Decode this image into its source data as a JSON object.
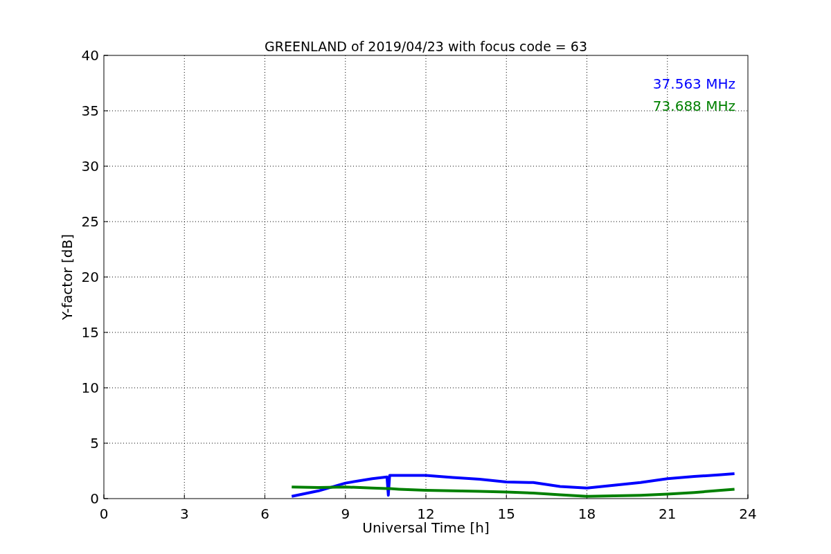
{
  "chart_data": {
    "type": "line",
    "title": "GREENLAND of 2019/04/23 with focus code = 63",
    "xlabel": "Universal Time [h]",
    "ylabel": "Y-factor [dB]",
    "x": [
      7,
      8,
      9,
      10,
      10.55,
      10.6,
      10.65,
      11,
      12,
      13,
      14,
      15,
      16,
      17,
      18,
      19,
      20,
      21,
      22,
      23,
      23.5
    ],
    "series": [
      {
        "name": "37.563 MHz",
        "color": "#0000ff",
        "values": [
          0.2,
          0.7,
          1.4,
          1.8,
          1.95,
          0.3,
          2.1,
          2.1,
          2.1,
          1.9,
          1.75,
          1.5,
          1.45,
          1.1,
          0.95,
          1.2,
          1.45,
          1.8,
          2.0,
          2.15,
          2.25
        ]
      },
      {
        "name": "73.688 MHz",
        "color": "#008000",
        "values": [
          1.05,
          1.0,
          1.05,
          0.95,
          0.9,
          0.9,
          0.9,
          0.85,
          0.75,
          0.7,
          0.65,
          0.6,
          0.5,
          0.35,
          0.2,
          0.25,
          0.3,
          0.4,
          0.55,
          0.75,
          0.85
        ]
      }
    ],
    "grid": true,
    "xlim": [
      0,
      24
    ],
    "ylim": [
      0,
      40
    ],
    "xticks": [
      0,
      3,
      6,
      9,
      12,
      15,
      18,
      21,
      24
    ],
    "yticks": [
      0,
      5,
      10,
      15,
      20,
      25,
      30,
      35,
      40
    ]
  }
}
